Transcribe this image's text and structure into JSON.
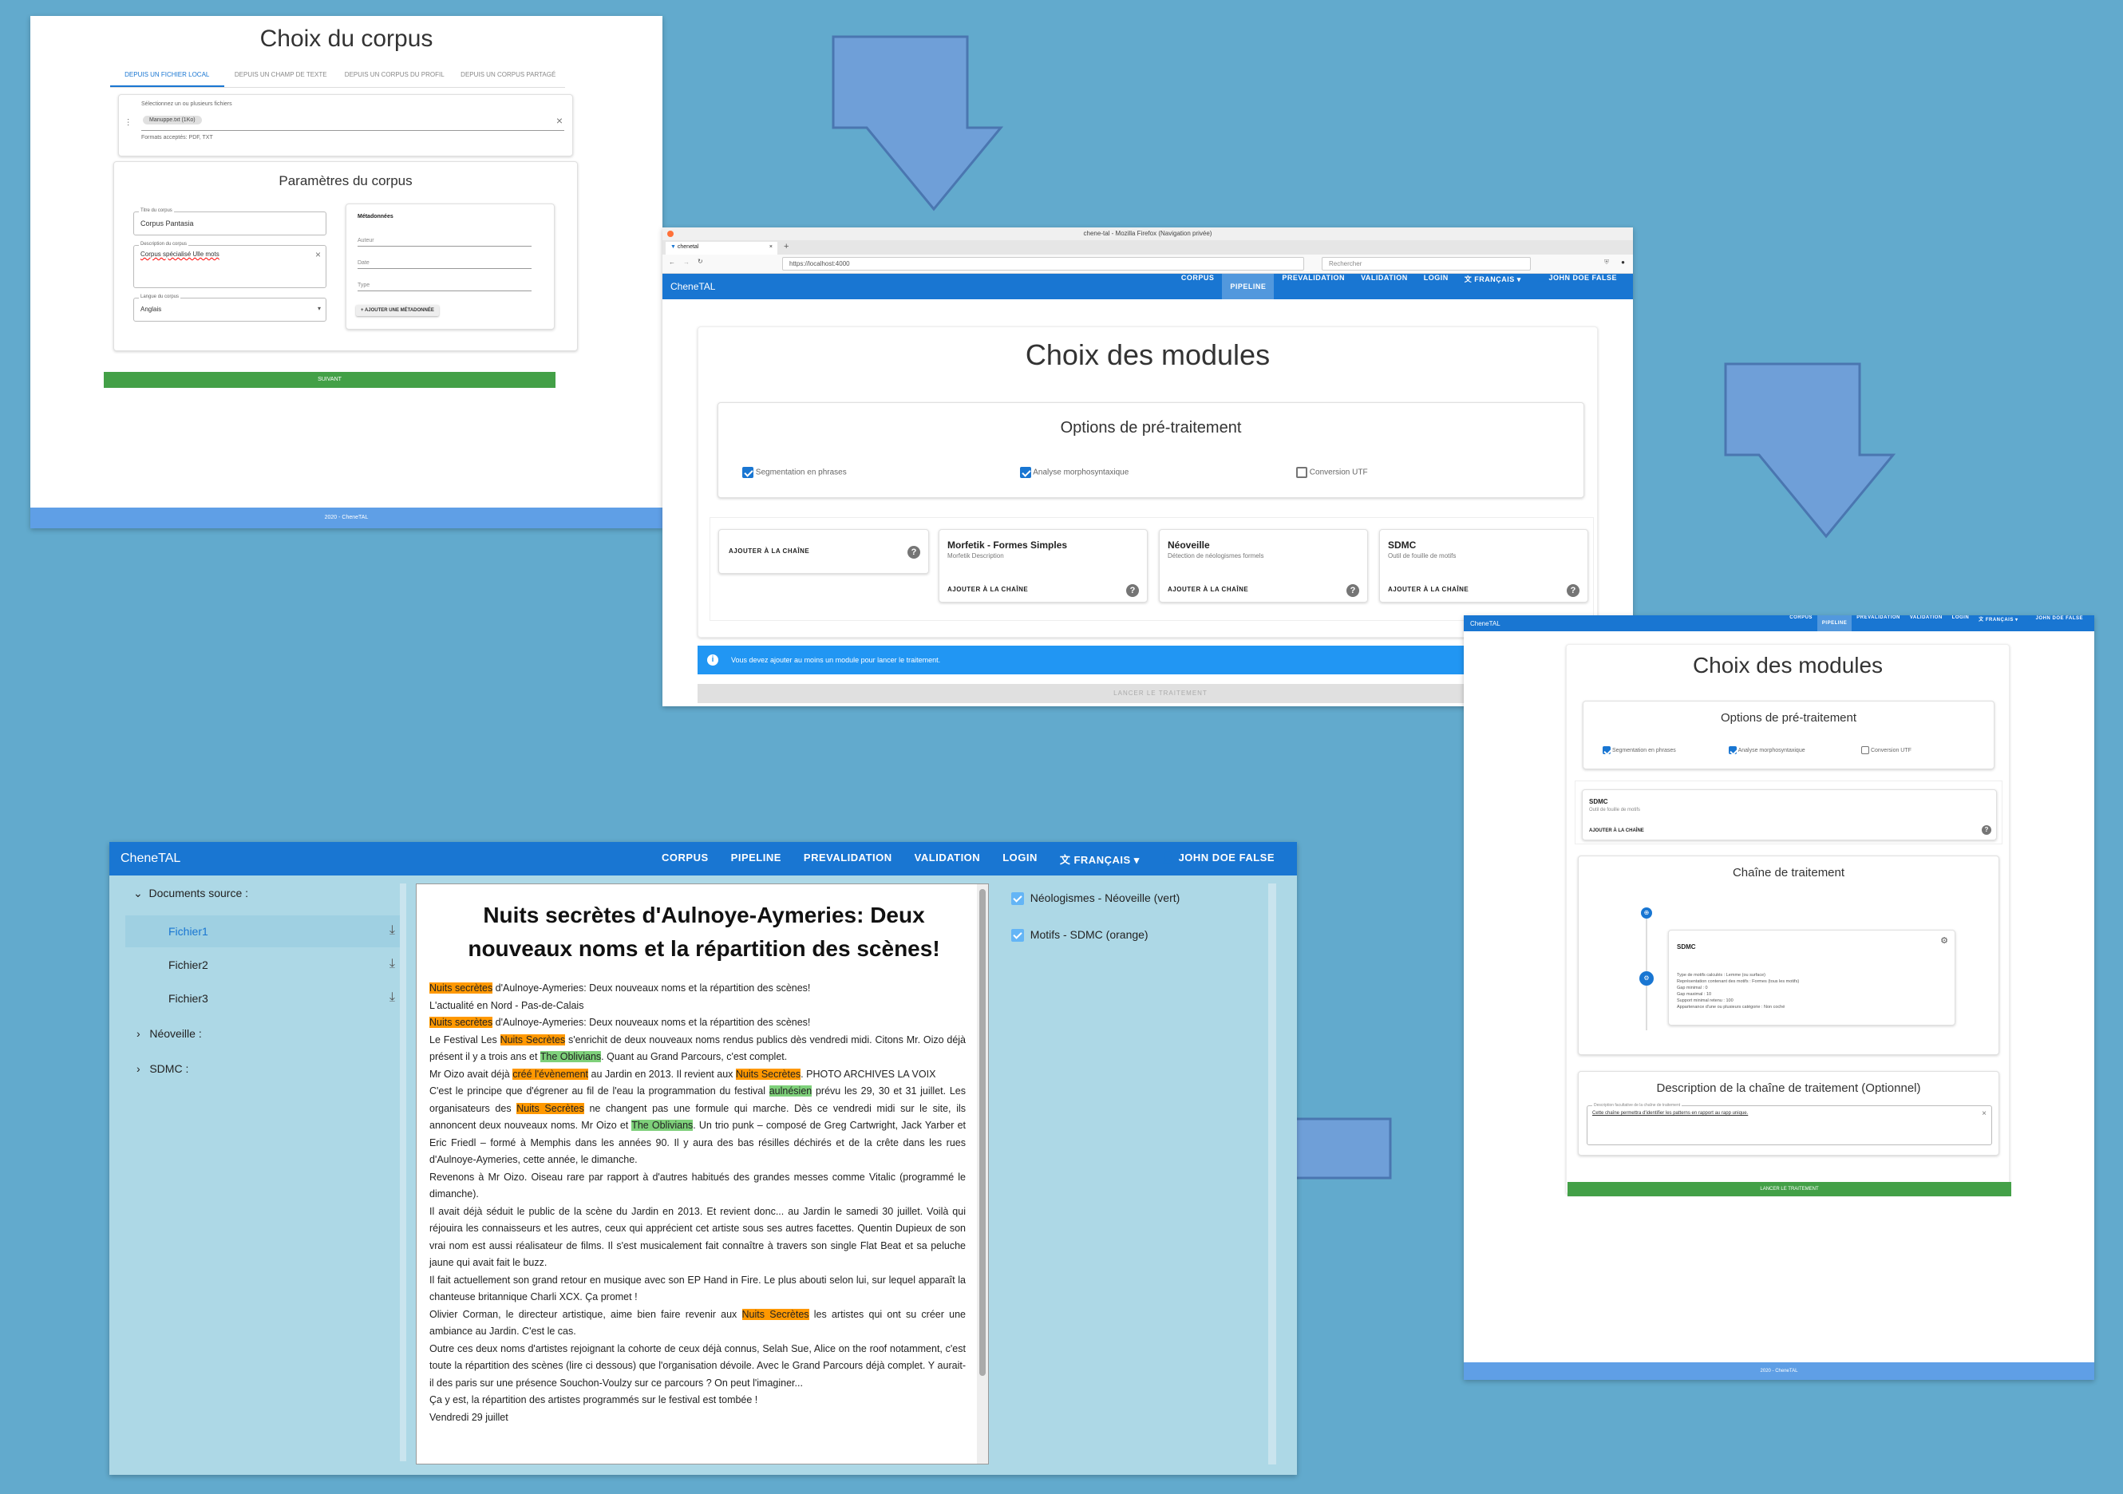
{
  "colors": {
    "background": "#62aacd",
    "primary": "#1976d2",
    "success": "#43a047",
    "orange": "#ff9800",
    "green": "#7ed07a",
    "arrow": "#6f9fd8"
  },
  "icons": {
    "arrow_down": "arrow-down-icon",
    "arrow_left": "arrow-left-icon",
    "help": "help-icon",
    "download": "download-icon",
    "chevron": "chevron-icon",
    "user": "user-icon",
    "translate": "translate-icon",
    "close": "close-icon",
    "attach": "attach-icon"
  },
  "nav": {
    "brand": "ChenеTAL",
    "links": [
      "CORPUS",
      "PIPELINE",
      "PREVALIDATION",
      "VALIDATION",
      "LOGIN",
      "文 FRANÇAIS ▾",
      "👤 JOHN DOE FALSE"
    ]
  },
  "screen1": {
    "title": "Choix du corpus",
    "tabs": [
      "DEPUIS UN FICHIER LOCAL",
      "DEPUIS UN CHAMP DE TEXTE",
      "DEPUIS UN CORPUS DU PROFIL",
      "DEPUIS UN CORPUS PARTAGÉ"
    ],
    "file_label": "Sélectionnez un ou plusieurs fichiers",
    "file_chip": "Manuppe.txt (1Ko)",
    "file_hint": "Formats acceptés: PDF, TXT",
    "params_title": "Paramètres du corpus",
    "name_label": "Titre du corpus",
    "name_value": "Corpus Pantasia",
    "desc_label": "Description du corpus",
    "desc_value": "Corpus spécialisé Ulle mots",
    "lang_label": "Langue du corpus",
    "lang_value": "Anglais",
    "meta_title": "Métadonnées",
    "meta_fields": [
      "Auteur",
      "Date",
      "Type"
    ],
    "add_meta": "+ AJOUTER UNE MÉTADONNÉE",
    "next": "SUIVANT",
    "footer": "2020 - ChenеTAL"
  },
  "screen2": {
    "window_title": "chene-tal - Mozilla Firefox (Navigation privée)",
    "tab_label": "chenetal",
    "url": "https://localhost:4000",
    "search": "Rechercher",
    "title": "Choix des modules",
    "options_title": "Options de pré-traitement",
    "options": [
      {
        "label": "Segmentation en phrases",
        "checked": true
      },
      {
        "label": "Analyse morphosyntaxique",
        "checked": true
      },
      {
        "label": "Conversion UTF",
        "checked": false
      }
    ],
    "modules": [
      {
        "name": "",
        "desc": ""
      },
      {
        "name": "Morfetik - Formes Simples",
        "desc": "Morfetik Description"
      },
      {
        "name": "Néoveille",
        "desc": "Détection de néologismes formels"
      },
      {
        "name": "SDMC",
        "desc": "Outil de fouille de motifs"
      }
    ],
    "add_chain": "AJOUTER À LA CHAÎNE",
    "info": "Vous devez ajouter au moins un module pour lancer le traitement.",
    "launch": "LANCER LE TRAITEMENT"
  },
  "screen3": {
    "title": "Choix des modules",
    "options_title": "Options de pré-traitement",
    "options": [
      {
        "label": "Segmentation en phrases",
        "checked": true
      },
      {
        "label": "Analyse morphosyntaxique",
        "checked": true
      },
      {
        "label": "Conversion UTF",
        "checked": false
      }
    ],
    "module_name": "SDMC",
    "module_desc": "Outil de fouille de motifs",
    "add_chain": "AJOUTER À LA CHAÎNE",
    "chain_title": "Chaîne de traitement",
    "chain_card_title": "SDMC",
    "chain_params": [
      "Type de motifs calculés : Lemme (ou surface)",
      "Représentation contenant des motifs : Formes (tous les motifs)",
      "Gap minimal : 0",
      "Gap maximal : 10",
      "Support minimal retenu : 100",
      "Appartenance d'une ou plusieurs catégorie : Non coché"
    ],
    "desc_title": "Description de la chaîne de traitement (Optionnel)",
    "desc_label": "Description facultative de la chaîne de traitement",
    "desc_value": "Cette chaîne permettra d'identifier les patterns en rapport au rapp unique.",
    "launch": "LANCER LE TRAITEMENT",
    "footer": "2020 - ChenеTAL"
  },
  "screen4": {
    "tree": {
      "root": "Documents source :",
      "files": [
        "Fichier1",
        "Fichier2",
        "Fichier3"
      ],
      "groups": [
        "Néoveille :",
        "SDMC :"
      ]
    },
    "doc_title": "Nuits secrètes d'Aulnoye-Aymeries: Deux nouveaux noms et la répartition des scènes!",
    "legend": [
      "Néologismes - Néoveille (vert)",
      "Motifs - SDMC (orange)"
    ],
    "paragraphs": [
      [
        [
          "o",
          "Nuits secrètes"
        ],
        [
          "t",
          " d'Aulnoye-Aymeries: Deux nouveaux noms et la répartition des scènes!"
        ]
      ],
      [
        [
          "t",
          "L'actualité en Nord - Pas-de-Calais"
        ]
      ],
      [
        [
          "t",
          " "
        ]
      ],
      [
        [
          "o",
          "Nuits secrètes"
        ],
        [
          "t",
          " d'Aulnoye-Aymeries: Deux nouveaux noms et la répartition des scènes!"
        ]
      ],
      [
        [
          "t",
          "Le Festival Les "
        ],
        [
          "o",
          "Nuits Secrètes"
        ],
        [
          "t",
          " s'enrichit de deux nouveaux noms rendus publics dès vendredi midi. Citons Mr. Oizo déjà présent il y a trois ans et "
        ],
        [
          "g",
          "The Oblivians"
        ],
        [
          "t",
          ". Quant au Grand Parcours, c'est complet."
        ]
      ],
      [
        [
          "t",
          "Mr Oizo avait déjà "
        ],
        [
          "o",
          "créé l'évènement"
        ],
        [
          "t",
          " au Jardin en 2013. Il revient aux "
        ],
        [
          "o",
          "Nuits Secrètes"
        ],
        [
          "t",
          ". PHOTO ARCHIVES LA VOIX"
        ]
      ],
      [
        [
          "t",
          "C'est le principe que d'égrener au fil de l'eau la programmation du festival "
        ],
        [
          "g",
          "aulnésien"
        ],
        [
          "t",
          " prévu les 29, 30 et 31 juillet. Les organisateurs des "
        ],
        [
          "o",
          "Nuits Secrètes"
        ],
        [
          "t",
          " ne changent pas une formule qui marche. Dès ce vendredi midi sur le site, ils annoncent deux nouveaux noms. Mr Oizo et "
        ],
        [
          "g",
          "The Oblivians"
        ],
        [
          "t",
          ". Un trio punk – composé de Greg Cartwright, Jack Yarber et Eric Friedl – formé à Memphis dans les années 90. Il y aura des bas résilles déchirés et de la crête dans les rues d'Aulnoye-Aymeries, cette année, le dimanche."
        ]
      ],
      [
        [
          "t",
          "Revenons à Mr Oizo. Oiseau rare par rapport à d'autres habitués des grandes messes comme Vitalic (programmé le dimanche)."
        ]
      ],
      [
        [
          "t",
          "Il avait déjà séduit le public de la scène du Jardin en 2013. Et revient donc... au Jardin le samedi 30 juillet. Voilà qui réjouira les connaisseurs et les autres, ceux qui apprécient cet artiste sous ses autres facettes. Quentin Dupieux de son vrai nom est aussi réalisateur de films. Il s'est musicalement fait connaître à travers son single Flat Beat et sa peluche jaune qui avait fait le buzz."
        ]
      ],
      [
        [
          "t",
          "Il fait actuellement son grand retour en musique avec son EP Hand in Fire. Le plus abouti selon lui, sur lequel apparaît la chanteuse britannique Charli XCX. Ça promet !"
        ]
      ],
      [
        [
          "t",
          "Olivier Corman, le directeur artistique, aime bien faire revenir aux "
        ],
        [
          "o",
          "Nuits Secrètes"
        ],
        [
          "t",
          " les artistes qui ont su créer une ambiance au Jardin. C'est le cas."
        ]
      ],
      [
        [
          "t",
          "Outre ces deux noms d'artistes rejoignant la cohorte de ceux déjà connus, Selah Sue, Alice on the roof notamment, c'est toute la répartition des scènes (lire ci dessous) que l'organisation dévoile. Avec le Grand Parcours déjà complet. Y aurait-il des paris sur une présence Souchon-Voulzy sur ce parcours ? On peut l'imaginer..."
        ]
      ],
      [
        [
          "t",
          "Ça y est, la répartition des artistes programmés sur le festival est tombée !"
        ]
      ],
      [
        [
          "t",
          "Vendredi 29 juillet"
        ]
      ]
    ]
  }
}
